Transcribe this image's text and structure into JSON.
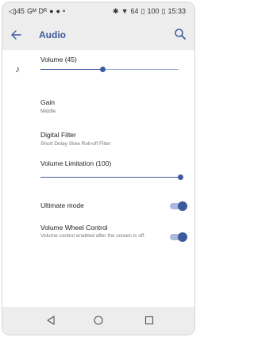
{
  "status_bar": {
    "left_items": [
      "◁)45",
      "Gᴹ",
      "Dᴿ",
      "●",
      "●",
      "•"
    ],
    "bluetooth": "✱",
    "wifi": "▼",
    "battery_a": "64",
    "battery_b": "100",
    "time": "15:33"
  },
  "app_bar": {
    "title": "Audio"
  },
  "settings": {
    "volume": {
      "label": "Volume (45)",
      "value": 45,
      "max": 100
    },
    "gain": {
      "label": "Gain",
      "value": "Middle"
    },
    "digital_filter": {
      "label": "Digital Filter",
      "value": "Short Delay Slow Roll-off Filter"
    },
    "volume_limitation": {
      "label": "Volume Limitation (100)",
      "value": 100,
      "max": 100
    },
    "ultimate_mode": {
      "label": "Ultimate mode",
      "enabled": true
    },
    "volume_wheel_control": {
      "label": "Volume Wheel Control",
      "description": "Volume control enabled after the screen is off.",
      "enabled": true
    }
  },
  "colors": {
    "accent": "#3d5a9e",
    "track": "#8ea3cf",
    "bars": "#ededed"
  }
}
